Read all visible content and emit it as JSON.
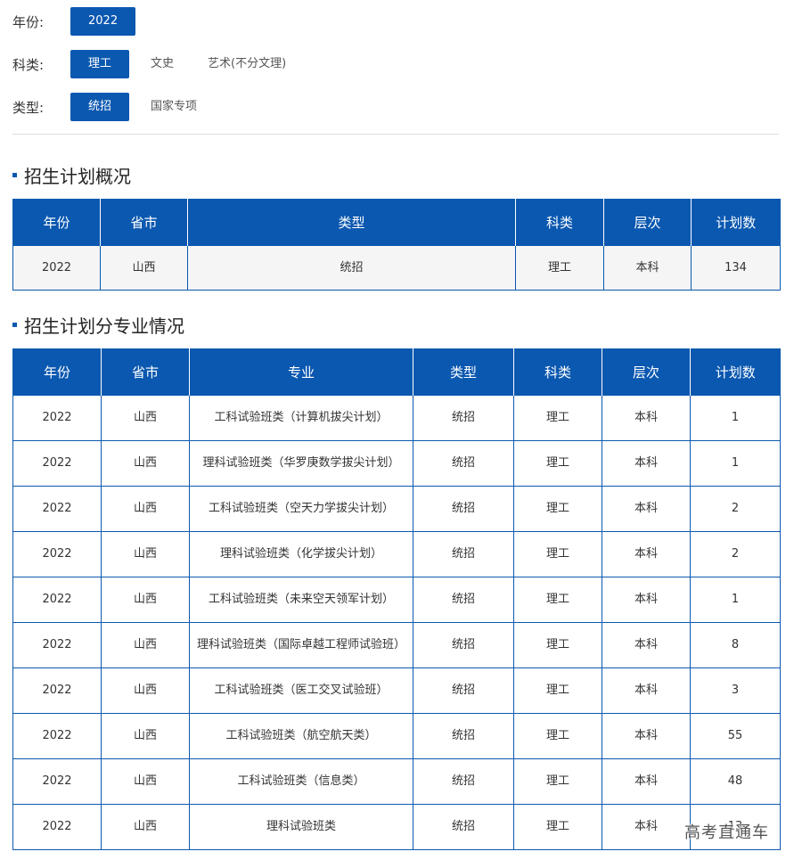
{
  "filters": {
    "year": {
      "label": "年份:",
      "options": [
        "2022"
      ],
      "selected": 0
    },
    "subject": {
      "label": "科类:",
      "options": [
        "理工",
        "文史",
        "艺术(不分文理)"
      ],
      "selected": 0
    },
    "type": {
      "label": "类型:",
      "options": [
        "统招",
        "国家专项"
      ],
      "selected": 0
    }
  },
  "overview": {
    "title": "招生计划概况",
    "headers": [
      "年份",
      "省市",
      "类型",
      "科类",
      "层次",
      "计划数"
    ],
    "rows": [
      [
        "2022",
        "山西",
        "统招",
        "理工",
        "本科",
        "134"
      ]
    ]
  },
  "majors": {
    "title": "招生计划分专业情况",
    "headers": [
      "年份",
      "省市",
      "专业",
      "类型",
      "科类",
      "层次",
      "计划数"
    ],
    "rows": [
      [
        "2022",
        "山西",
        "工科试验班类（计算机拔尖计划）",
        "统招",
        "理工",
        "本科",
        "1"
      ],
      [
        "2022",
        "山西",
        "理科试验班类（华罗庚数学拔尖计划）",
        "统招",
        "理工",
        "本科",
        "1"
      ],
      [
        "2022",
        "山西",
        "工科试验班类（空天力学拔尖计划）",
        "统招",
        "理工",
        "本科",
        "2"
      ],
      [
        "2022",
        "山西",
        "理科试验班类（化学拔尖计划）",
        "统招",
        "理工",
        "本科",
        "2"
      ],
      [
        "2022",
        "山西",
        "工科试验班类（未来空天领军计划）",
        "统招",
        "理工",
        "本科",
        "1"
      ],
      [
        "2022",
        "山西",
        "理科试验班类（国际卓越工程师试验班）",
        "统招",
        "理工",
        "本科",
        "8"
      ],
      [
        "2022",
        "山西",
        "工科试验班类（医工交叉试验班）",
        "统招",
        "理工",
        "本科",
        "3"
      ],
      [
        "2022",
        "山西",
        "工科试验班类（航空航天类）",
        "统招",
        "理工",
        "本科",
        "55"
      ],
      [
        "2022",
        "山西",
        "工科试验班类（信息类）",
        "统招",
        "理工",
        "本科",
        "48"
      ],
      [
        "2022",
        "山西",
        "理科试验班类",
        "统招",
        "理工",
        "本科",
        "13"
      ]
    ]
  },
  "watermark": "高考直通车",
  "colors": {
    "accent": "#0b58b0",
    "row_alt": "#f5f5f5"
  }
}
